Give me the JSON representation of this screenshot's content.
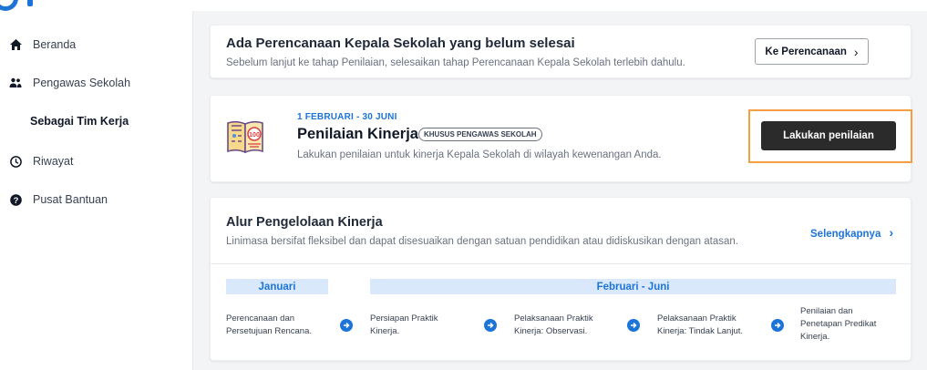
{
  "sidebar": {
    "items": [
      {
        "label": "Beranda",
        "icon": "home-icon"
      },
      {
        "label": "Pengawas Sekolah",
        "icon": "people-icon"
      },
      {
        "label": "Sebagai Tim Kerja"
      },
      {
        "label": "Riwayat",
        "icon": "clock-icon"
      },
      {
        "label": "Pusat Bantuan",
        "icon": "help-icon"
      }
    ]
  },
  "notice": {
    "title": "Ada Perencanaan Kepala Sekolah yang belum selesai",
    "subtitle": "Sebelum lanjut ke tahap Penilaian, selesaikan tahap Perencanaan Kepala Sekolah terlebih dahulu.",
    "button_label": "Ke Perencanaan",
    "button_chevron": "›"
  },
  "assessment": {
    "date": "1 FEBRUARI - 30 JUNI",
    "title": "Penilaian Kinerja",
    "badge": "KHUSUS PENGAWAS SEKOLAH",
    "description": "Lakukan penilaian untuk kinerja Kepala Sekolah di wilayah kewenangan Anda.",
    "button_label": "Lakukan penilaian"
  },
  "flow": {
    "title": "Alur Pengelolaan Kinerja",
    "subtitle": "Linimasa bersifat fleksibel dan dapat disesuaikan dengan satuan pendidikan atau didiskusikan dengan atasan.",
    "more_label": "Selengkapnya",
    "more_chevron": "›",
    "phases": [
      {
        "label": "Januari"
      },
      {
        "label": "Februari - Juni"
      }
    ],
    "steps": [
      {
        "line1": "Perencanaan dan",
        "line2": "Persetujuan Rencana.",
        "line3": ""
      },
      {
        "line1": "Persiapan Praktik",
        "line2": "Kinerja.",
        "line3": ""
      },
      {
        "line1": "Pelaksanaan Praktik",
        "line2": "Kinerja: Observasi.",
        "line3": ""
      },
      {
        "line1": "Pelaksanaan Praktik",
        "line2": "Kinerja: Tindak Lanjut.",
        "line3": ""
      },
      {
        "line1": "Penilaian dan",
        "line2": "Penetapan Predikat",
        "line3": "Kinerja."
      }
    ]
  },
  "colors": {
    "accent": "#1d74d7",
    "highlight": "#f59e42",
    "dark_button": "#2b2b2b"
  }
}
